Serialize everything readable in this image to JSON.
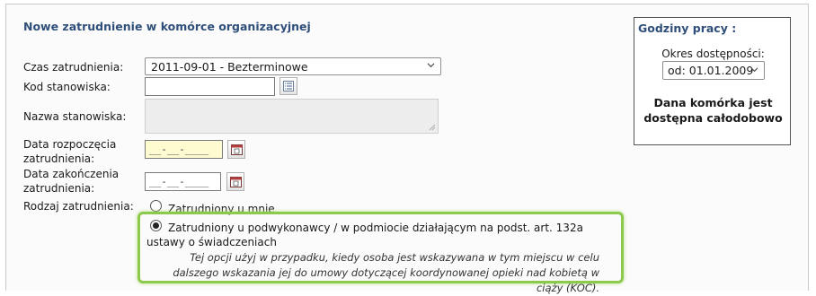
{
  "section": {
    "title": "Nowe zatrudnienie w komórce organizacyjnej"
  },
  "form": {
    "employment_time_label": "Czas zatrudnienia:",
    "employment_time_value": "2011-09-01 - Bezterminowe",
    "position_code_label": "Kod stanowiska:",
    "position_code_value": "",
    "position_name_label": "Nazwa stanowiska:",
    "start_date_label": "Data rozpoczęcia zatrudnienia:",
    "start_date_value": "__-__-____",
    "end_date_label": "Data zakończenia zatrudnienia:",
    "end_date_value": "__-__-____",
    "employment_type_label": "Rodzaj zatrudnienia:",
    "employment_type_options": [
      {
        "label": "Zatrudniony u mnie",
        "checked": false
      },
      {
        "label": "Zatrudniony u podwykonawcy / w podmiocie działającym na podst. art. 132a ustawy o świadczeniach",
        "checked": true
      }
    ],
    "hint": "Tej opcji użyj w przypadku, kiedy osoba jest wskazywana w tym miejscu w celu dalszego wskazania jej do umowy dotyczącej koordynowanej opieki nad kobietą w ciąży (KOC)."
  },
  "working_hours": {
    "title": "Godziny pracy :",
    "availability_label": "Okres dostępności:",
    "availability_value": "od: 01.01.2009",
    "message": "Dana komórka jest dostępna całodobowo"
  },
  "colors": {
    "accent": "#2f4f7a",
    "highlight": "#8dc94a",
    "date_fill": "#fffbd1"
  },
  "icons": [
    "chevron-down-icon",
    "list-picker-icon",
    "calendar-icon",
    "resize-grip-icon"
  ]
}
